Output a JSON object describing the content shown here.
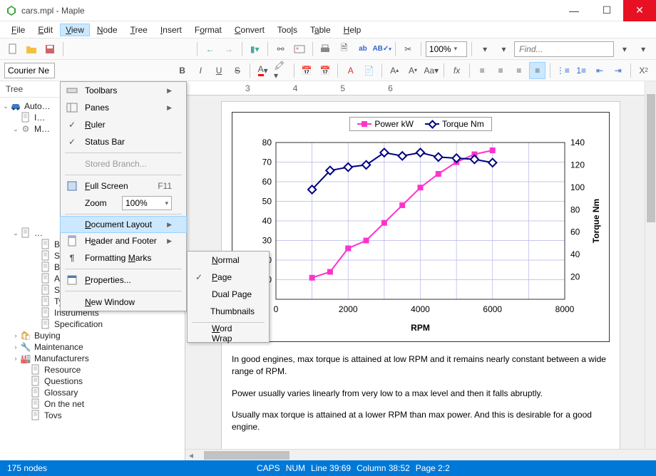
{
  "window": {
    "title": "cars.mpl - Maple"
  },
  "menubar": [
    "File",
    "Edit",
    "View",
    "Node",
    "Tree",
    "Insert",
    "Format",
    "Convert",
    "Tools",
    "Table",
    "Help"
  ],
  "menubar_active_index": 2,
  "toolbar1": {
    "zoom": "100%",
    "find_placeholder": "Find..."
  },
  "toolbar2": {
    "font_name": "Courier Ne"
  },
  "view_menu": {
    "toolbars": "Toolbars",
    "panes": "Panes",
    "ruler": "Ruler",
    "statusbar": "Status Bar",
    "stored_branch": "Stored Branch...",
    "full_screen": "Full Screen",
    "full_screen_kbd": "F11",
    "zoom_label": "Zoom",
    "zoom_value": "100%",
    "doc_layout": "Document Layout",
    "header_footer": "Header and Footer",
    "formatting_marks": "Formatting Marks",
    "properties": "Properties...",
    "new_window": "New Window"
  },
  "layout_submenu": {
    "normal": "Normal",
    "page": "Page",
    "dual_page": "Dual Page",
    "thumbnails": "Thumbnails",
    "word_wrap": "Word Wrap"
  },
  "tree": {
    "header": "Tree",
    "root": "Auto",
    "partial_items": [
      "I",
      "M"
    ],
    "items": [
      "Brake",
      "Suspension",
      "Body",
      "Accessories",
      "Safety",
      "Tyre",
      "Instruments",
      "Specification"
    ],
    "bottom_groups": [
      {
        "label": "Buying",
        "icon": "bag"
      },
      {
        "label": "Maintenance",
        "icon": "wrench"
      },
      {
        "label": "Manufacturers",
        "icon": "factory"
      }
    ],
    "bottom_items": [
      "Resource",
      "Questions",
      "Glossary",
      "On the net",
      "Tovs"
    ]
  },
  "chart_data": {
    "type": "line",
    "title": "",
    "xlabel": "RPM",
    "ylabel_left": "",
    "ylabel_right": "Torque Nm",
    "x": [
      1000,
      1500,
      2000,
      2500,
      3000,
      3500,
      4000,
      4500,
      5000,
      5500,
      6000
    ],
    "series": [
      {
        "name": "Power kW",
        "axis": "left",
        "color": "#ff33cc",
        "marker": "square",
        "values": [
          11,
          14,
          26,
          30,
          39,
          48,
          57,
          64,
          70,
          74,
          76
        ]
      },
      {
        "name": "Torque Nm",
        "axis": "right",
        "color": "#000080",
        "marker": "diamond",
        "values": [
          98,
          115,
          118,
          120,
          131,
          128,
          131,
          127,
          126,
          125,
          122
        ]
      }
    ],
    "xlim": [
      0,
      8000
    ],
    "ylim_left": [
      0,
      80
    ],
    "ylim_right": [
      0,
      140
    ],
    "yticks_left": [
      10,
      20,
      30,
      40,
      50,
      60,
      70,
      80
    ],
    "yticks_right": [
      20,
      40,
      60,
      80,
      100,
      120,
      140
    ],
    "xticks": [
      0,
      2000,
      4000,
      6000,
      8000
    ]
  },
  "body_paragraphs": [
    "In good engines, max torque is attained at low RPM and it remains nearly constant between a wide range of RPM.",
    "Power usually varies linearly from very low to a max level and then it falls abruptly.",
    "Usually max torque is attained at a lower RPM than max power. And this is desirable for a good engine."
  ],
  "ruler_marks": [
    "3",
    "4",
    "5",
    "6"
  ],
  "statusbar": {
    "left": "175 nodes",
    "caps": "CAPS",
    "num": "NUM",
    "line": "Line 39:69",
    "col": "Column 38:52",
    "page": "Page 2:2"
  }
}
